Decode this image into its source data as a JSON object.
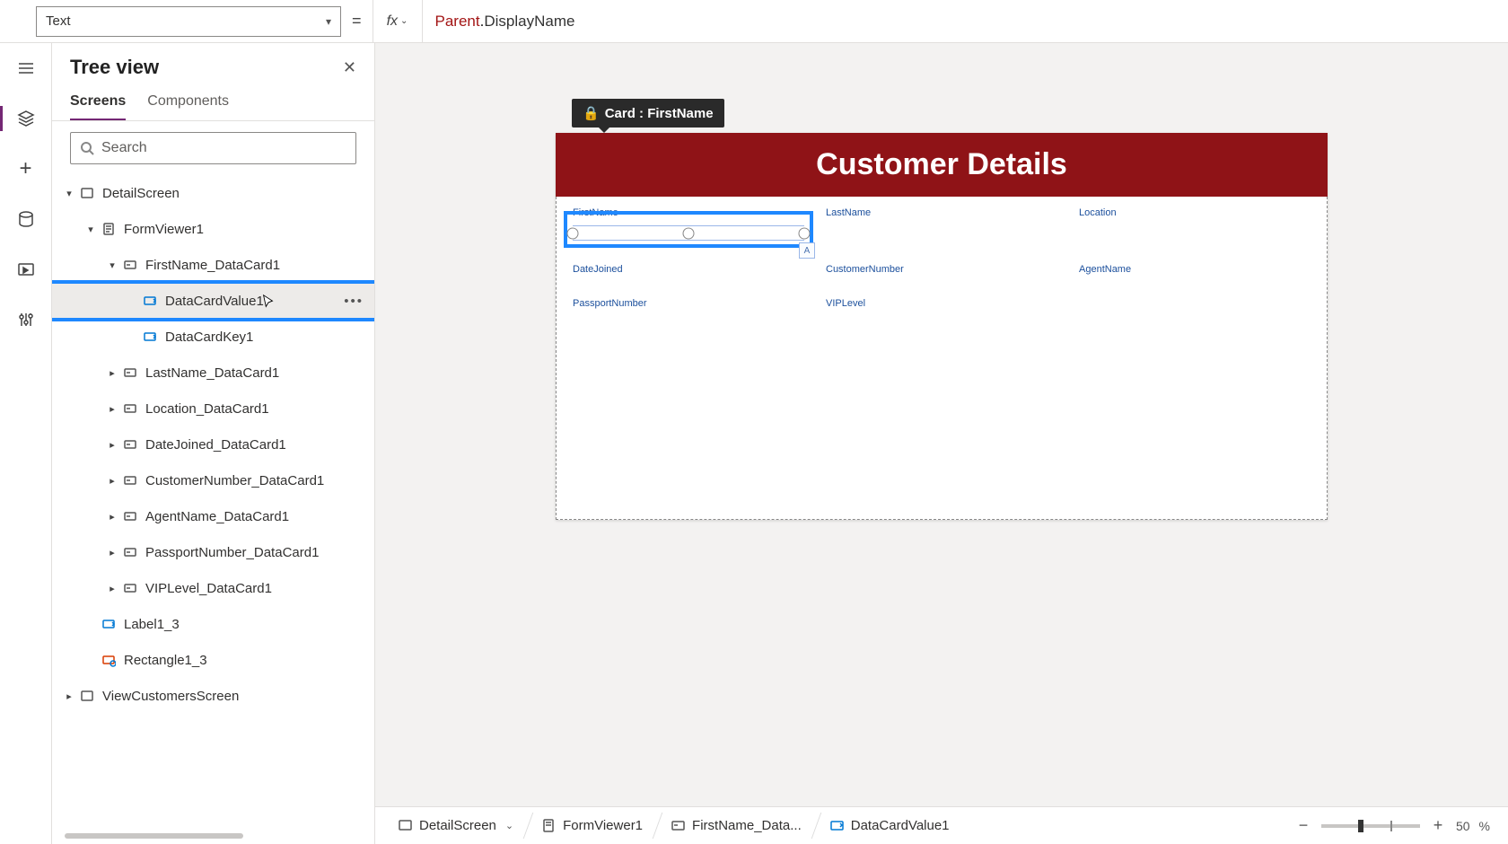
{
  "topbar": {
    "property": "Text",
    "formula_parent": "Parent",
    "formula_dot": ".",
    "formula_prop": "DisplayName",
    "equals": "="
  },
  "tree": {
    "title": "Tree view",
    "tabs": {
      "screens": "Screens",
      "components": "Components"
    },
    "search_placeholder": "Search",
    "items": {
      "detailScreen": "DetailScreen",
      "formViewer": "FormViewer1",
      "firstNameCard": "FirstName_DataCard1",
      "dataCardValue": "DataCardValue1",
      "dataCardKey": "DataCardKey1",
      "lastNameCard": "LastName_DataCard1",
      "locationCard": "Location_DataCard1",
      "dateJoinedCard": "DateJoined_DataCard1",
      "customerNumberCard": "CustomerNumber_DataCard1",
      "agentNameCard": "AgentName_DataCard1",
      "passportNumberCard": "PassportNumber_DataCard1",
      "vipLevelCard": "VIPLevel_DataCard1",
      "label": "Label1_3",
      "rectangle": "Rectangle1_3",
      "viewCustomers": "ViewCustomersScreen"
    }
  },
  "canvas": {
    "cardTag": "Card : FirstName",
    "header": "Customer Details",
    "fields": {
      "firstName": "FirstName",
      "lastName": "LastName",
      "location": "Location",
      "dateJoined": "DateJoined",
      "customerNumber": "CustomerNumber",
      "agentName": "AgentName",
      "passportNumber": "PassportNumber",
      "vipLevel": "VIPLevel"
    }
  },
  "breadcrumb": {
    "detailScreen": "DetailScreen",
    "formViewer": "FormViewer1",
    "firstNameCard": "FirstName_Data...",
    "dataCardValue": "DataCardValue1"
  },
  "zoom": {
    "minus": "−",
    "plus": "+",
    "value": "50",
    "pct": "%"
  }
}
